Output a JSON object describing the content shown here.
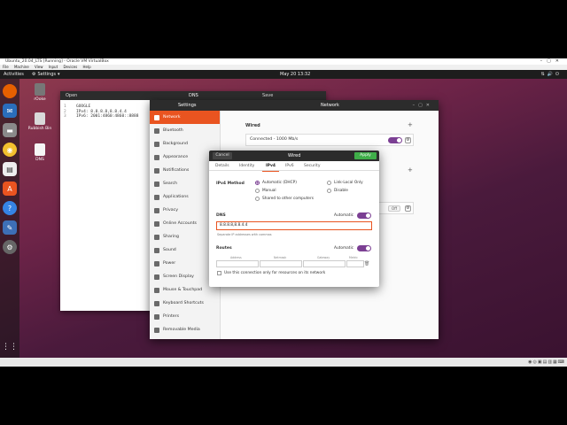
{
  "vbox": {
    "title": "Ubuntu_20.04_LTS [Running] - Oracle VM VirtualBox",
    "menu": [
      "File",
      "Machine",
      "View",
      "Input",
      "Devices",
      "Help"
    ]
  },
  "topbar": {
    "activities": "Activities",
    "app": "Settings",
    "clock": "May 20  13:32"
  },
  "desktop_icons": [
    {
      "label": "rOoke"
    },
    {
      "label": "Rubbish Bin"
    },
    {
      "label": "DNS"
    }
  ],
  "editor": {
    "open_label": "Open",
    "title": "DNS",
    "save_label": "Save",
    "lines": [
      {
        "n": "1",
        "text": "GOOGLE"
      },
      {
        "n": "2",
        "text": "IPv4: 8.8.8.8,8.8.4.4"
      },
      {
        "n": "3",
        "text": "IPv6: 2001:4860:4860::8888"
      }
    ]
  },
  "settings": {
    "title": "Settings",
    "panel_title": "Network",
    "sidebar": [
      "Network",
      "Bluetooth",
      "Background",
      "Appearance",
      "Notifications",
      "Search",
      "Applications",
      "Privacy",
      "Online Accounts",
      "Sharing",
      "Sound",
      "Power",
      "Screen Display",
      "Mouse & Touchpad",
      "Keyboard Shortcuts",
      "Printers",
      "Removable Media"
    ],
    "active_index": 0,
    "wired_label": "Wired",
    "wired_status": "Connected - 1000 Mb/s",
    "proxy_state": "Off"
  },
  "dialog": {
    "cancel": "Cancel",
    "title": "Wired",
    "apply": "Apply",
    "tabs": [
      "Details",
      "Identity",
      "IPv4",
      "IPv6",
      "Security"
    ],
    "active_tab": "IPv4",
    "ipv4_method_label": "IPv4 Method",
    "methods": [
      {
        "label": "Automatic (DHCP)",
        "selected": true
      },
      {
        "label": "Link-Local Only",
        "selected": false
      },
      {
        "label": "Manual",
        "selected": false
      },
      {
        "label": "Disable",
        "selected": false
      },
      {
        "label": "Shared to other computers",
        "selected": false
      }
    ],
    "dns_label": "DNS",
    "automatic": "Automatic",
    "dns_value": "8.8.8.8,8.8.4.4",
    "dns_hint": "Separate IP addresses with commas",
    "routes_label": "Routes",
    "route_cols": [
      "Address",
      "Netmask",
      "Gateway",
      "Metric"
    ],
    "only_resources": "Use this connection only for resources on its network"
  },
  "colors": {
    "accent": "#e95420",
    "toggle": "#7b3f93",
    "apply": "#3fae49"
  }
}
